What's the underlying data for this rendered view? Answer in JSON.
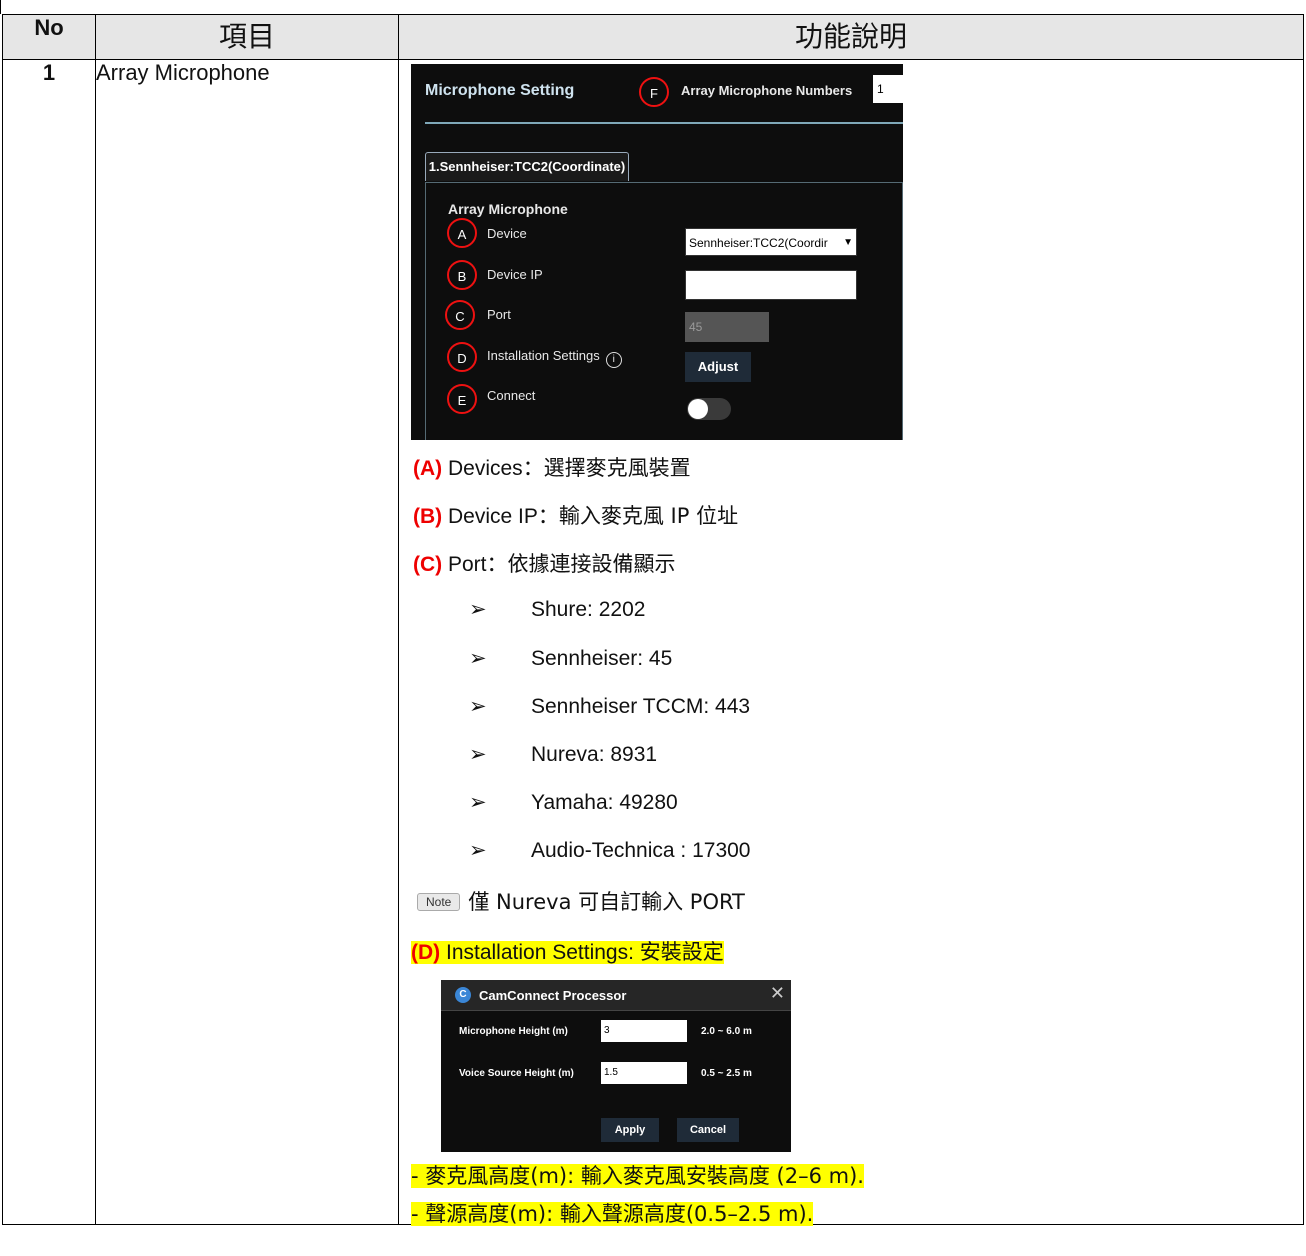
{
  "table": {
    "headers": {
      "no": "No",
      "item": "項目",
      "desc": "功能說明"
    },
    "row": {
      "no": "1",
      "item": "Array Microphone"
    }
  },
  "ui1": {
    "header": "Microphone Setting",
    "f_marker": "F",
    "array_numbers_label": "Array Microphone Numbers",
    "array_numbers_value": "1",
    "tab_label": "1.Sennheiser:TCC2(Coordinate)",
    "panel_title": "Array Microphone",
    "rows": [
      {
        "marker": "A",
        "label": "Device"
      },
      {
        "marker": "B",
        "label": "Device IP"
      },
      {
        "marker": "C",
        "label": "Port"
      },
      {
        "marker": "D",
        "label": "Installation Settings"
      },
      {
        "marker": "E",
        "label": "Connect"
      }
    ],
    "device_value": "Sennheiser:TCC2(Coordir",
    "port_placeholder": "45",
    "adjust_label": "Adjust",
    "info_icon": "i",
    "connect_state": "off"
  },
  "desc": {
    "a": {
      "tag": "(A)",
      "text": " Devices",
      "cjk": "：選擇麥克風裝置"
    },
    "b": {
      "tag": "(B)",
      "text": " Device IP",
      "cjk": "：輸入麥克風 IP 位址"
    },
    "c": {
      "tag": "(C)",
      "text": " Port",
      "cjk": "：依據連接設備顯示"
    },
    "bullet_icon": "➢",
    "ports": [
      "Shure: 2202",
      "Sennheiser: 45",
      "Sennheiser TCCM: 443",
      "Nureva: 8931",
      "Yamaha: 49280",
      "Audio-Technica : 17300"
    ],
    "note_badge": "Note",
    "note_text": "僅 Nureva  可自訂輸入 PORT",
    "d": {
      "tag": "(D)",
      "text": " Installation Settings:  ",
      "cjk": "安裝設定"
    },
    "mic_height_line": "-  麥克風高度(m):  輸入麥克風安裝高度  (2–6 m).",
    "voice_height_line": "-    聲源高度(m):  輸入聲源高度(0.5–2.5 m)."
  },
  "ui2": {
    "logo": "C",
    "title": "CamConnect Processor",
    "close_icon": "✕",
    "mic_height_label": "Microphone Height (m)",
    "mic_height_value": "3",
    "mic_height_range": "2.0 ~ 6.0 m",
    "voice_height_label": "Voice Source Height (m)",
    "voice_height_value": "1.5",
    "voice_height_range": "0.5 ~ 2.5 m",
    "apply_label": "Apply",
    "cancel_label": "Cancel"
  },
  "colors": {
    "marker_red": "#ee1111",
    "tag_red": "#e00000",
    "highlight": "#ffff00",
    "header_gray": "#e6e6e6",
    "ui_bg": "#0d0d0d"
  }
}
